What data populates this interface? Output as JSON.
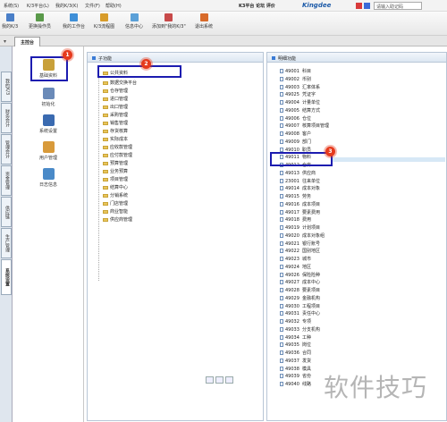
{
  "menubar": {
    "items": [
      "系统(S)",
      "K/3平台(L)",
      "我的K/3(K)",
      "文件(F)",
      "帮助(H)"
    ],
    "k3_links": "K3平台  论坛  评价",
    "brand": "Kingdee",
    "search_placeholder": "请输入助记码"
  },
  "toolbar": {
    "buttons": [
      {
        "label": "我的K/3",
        "icon": "home-icon",
        "color": "#4a7fc8"
      },
      {
        "label": "更换操作员",
        "icon": "switch-user-icon",
        "color": "#5a9a4a"
      },
      {
        "label": "我的工作台",
        "icon": "desktop-icon",
        "color": "#3e8fd8"
      },
      {
        "label": "K/3流程图",
        "icon": "flowchart-icon",
        "color": "#d89c2a"
      },
      {
        "label": "信息中心",
        "icon": "mail-icon",
        "color": "#5aa0d8"
      },
      {
        "label": "添加到\"我的K/3\"",
        "icon": "add-icon",
        "color": "#c84a4a"
      },
      {
        "label": "退出系统",
        "icon": "exit-icon",
        "color": "#d86a2a"
      }
    ]
  },
  "tabs": {
    "main": "主控台"
  },
  "vertical_tabs": [
    "我的K/3",
    "财务会计",
    "管理会计",
    "资金管理",
    "供应链",
    "生产管理",
    "系统设置"
  ],
  "left_modules": [
    {
      "label": "基础资料",
      "icon": "base-data-icon",
      "color": "#c8a03a"
    },
    {
      "label": "初始化",
      "icon": "init-icon",
      "color": "#6a8ab8"
    },
    {
      "label": "系统设置",
      "icon": "settings-icon",
      "color": "#3a6ab0"
    },
    {
      "label": "用户管理",
      "icon": "user-icon",
      "color": "#d89a3a"
    },
    {
      "label": "日志信息",
      "icon": "log-icon",
      "color": "#4a8ac8"
    }
  ],
  "mid_panel": {
    "header": "子功能",
    "items": [
      "公共资料",
      "数据交换平台",
      "仓存管理",
      "进口管理",
      "出口管理",
      "采购管理",
      "销售管理",
      "存货核算",
      "实际成本",
      "应收款管理",
      "应付款管理",
      "预算管理",
      "业务预算",
      "项目管理",
      "结算中心",
      "分销系统",
      "门店管理",
      "商业智能",
      "供应商管理"
    ]
  },
  "right_panel": {
    "header": "明细功能",
    "items": [
      [
        "49001",
        "科目"
      ],
      [
        "49002",
        "币别"
      ],
      [
        "49003",
        "汇率体系"
      ],
      [
        "49025",
        "凭证字"
      ],
      [
        "49004",
        "计量单位"
      ],
      [
        "49005",
        "结算方式"
      ],
      [
        "49006",
        "仓位"
      ],
      [
        "49007",
        "核算项目管理"
      ],
      [
        "49008",
        "客户"
      ],
      [
        "49009",
        "部门"
      ],
      [
        "49010",
        "职员"
      ],
      [
        "49011",
        "物料"
      ],
      [
        "49012",
        "仓库"
      ],
      [
        "49013",
        "供应商"
      ],
      [
        "23001",
        "往来单位"
      ],
      [
        "49014",
        "成本对象"
      ],
      [
        "49015",
        "劳务"
      ],
      [
        "49016",
        "成本项目"
      ],
      [
        "49017",
        "要素费用"
      ],
      [
        "49018",
        "费用"
      ],
      [
        "49019",
        "计划项目"
      ],
      [
        "49020",
        "成本对象组"
      ],
      [
        "49021",
        "银行账号"
      ],
      [
        "49022",
        "国别地区"
      ],
      [
        "49023",
        "城市"
      ],
      [
        "49024",
        "地区"
      ],
      [
        "49026",
        "保险险种"
      ],
      [
        "49027",
        "成本中心"
      ],
      [
        "49028",
        "要素项目"
      ],
      [
        "49029",
        "金融机构"
      ],
      [
        "49030",
        "工程项目"
      ],
      [
        "49031",
        "责任中心"
      ],
      [
        "49032",
        "专项"
      ],
      [
        "49033",
        "分支机构"
      ],
      [
        "49034",
        "工种"
      ],
      [
        "49035",
        "岗位"
      ],
      [
        "49036",
        "合同"
      ],
      [
        "49037",
        "发货"
      ],
      [
        "49038",
        "模具"
      ],
      [
        "49039",
        "省份"
      ],
      [
        "49040",
        "线路"
      ]
    ]
  },
  "badges": [
    "1",
    "2",
    "3"
  ],
  "watermark": "软件技巧"
}
